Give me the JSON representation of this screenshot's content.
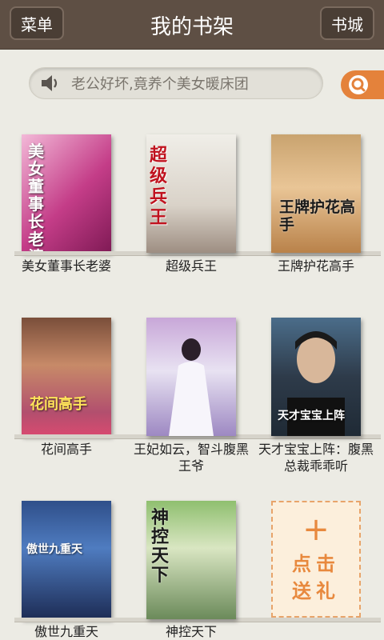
{
  "header": {
    "menu_label": "菜单",
    "title": "我的书架",
    "store_label": "书城"
  },
  "broadcast": {
    "text": "老公好坏,竟养个美女暖床团"
  },
  "colors": {
    "header_bg": "#5e4f44",
    "accent": "#e4823b",
    "page_bg": "#ecebe4"
  },
  "books": [
    {
      "title": "美女董事长老婆",
      "cover_text": "美女董事长老婆"
    },
    {
      "title": "超级兵王",
      "cover_text": "超级兵王"
    },
    {
      "title": "王牌护花高手",
      "cover_text": "王牌护花高手"
    },
    {
      "title": "花间高手",
      "cover_text": "花间高手"
    },
    {
      "title": "王妃如云，智斗腹黑王爷",
      "cover_text": ""
    },
    {
      "title": "天才宝宝上阵：腹黑总裁乖乖听",
      "cover_text": "天才宝宝上阵"
    },
    {
      "title": "傲世九重天",
      "cover_text": "傲世九重天"
    },
    {
      "title": "神控天下",
      "cover_text": "神控天下"
    }
  ],
  "gift": {
    "plus": "+",
    "line1": "点击",
    "line2": "送礼"
  }
}
